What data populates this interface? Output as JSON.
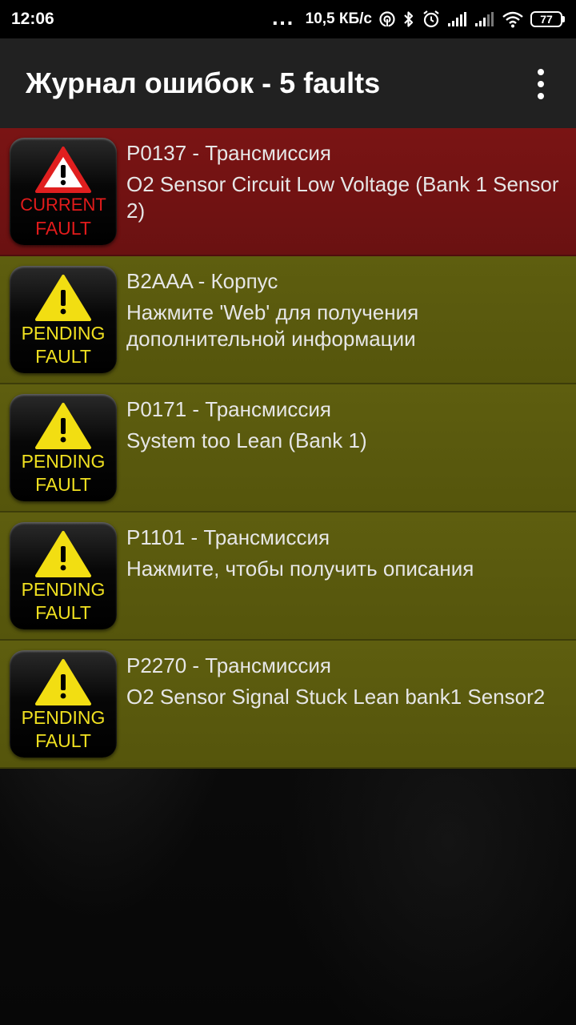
{
  "status_bar": {
    "time": "12:06",
    "dots": "...",
    "speed": "10,5 КБ/с",
    "battery": "77",
    "icons": [
      "hotspot-icon",
      "bluetooth-icon",
      "alarm-icon",
      "signal-icon",
      "signal-icon",
      "wifi-icon",
      "battery-icon"
    ]
  },
  "app_bar": {
    "title": "Журнал ошибок - 5 faults",
    "menu_icon": "overflow-menu-icon"
  },
  "colors": {
    "current_row": "#6e1212",
    "pending_row": "#58580d",
    "current_badge_text": "#e21b1b",
    "pending_badge_text": "#f0e020"
  },
  "faults": [
    {
      "status": "current",
      "badge_line1": "CURRENT",
      "badge_line2": "FAULT",
      "code": "P0137 - Трансмиссия",
      "description": "O2 Sensor Circuit Low Voltage (Bank 1 Sensor 2)"
    },
    {
      "status": "pending",
      "badge_line1": "PENDING",
      "badge_line2": "FAULT",
      "code": "B2AAA - Корпус",
      "description": "Нажмите 'Web' для получения дополнительной информации"
    },
    {
      "status": "pending",
      "badge_line1": "PENDING",
      "badge_line2": "FAULT",
      "code": "P0171 - Трансмиссия",
      "description": "System too Lean (Bank 1)"
    },
    {
      "status": "pending",
      "badge_line1": "PENDING",
      "badge_line2": "FAULT",
      "code": "P1101 - Трансмиссия",
      "description": "Нажмите, чтобы получить описания"
    },
    {
      "status": "pending",
      "badge_line1": "PENDING",
      "badge_line2": "FAULT",
      "code": "P2270 - Трансмиссия",
      "description": "O2 Sensor Signal Stuck Lean bank1 Sensor2"
    }
  ]
}
